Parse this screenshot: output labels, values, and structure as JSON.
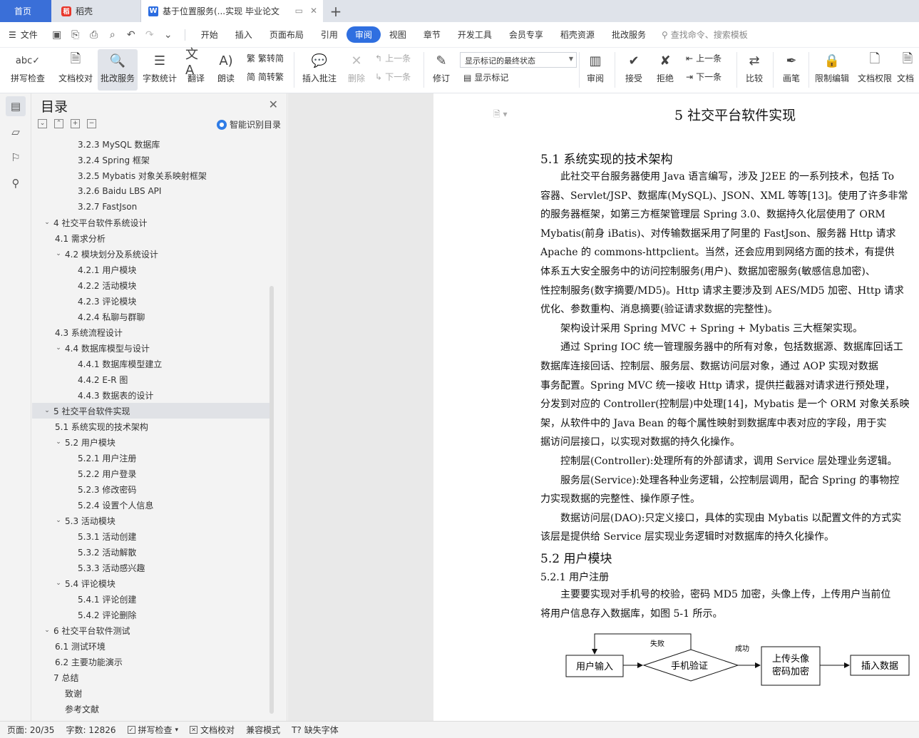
{
  "tabs": {
    "home": "首页",
    "daoke": "稻壳",
    "doc": "基于位置服务(...实现 毕业论文"
  },
  "menubar": {
    "file": "文件",
    "items": [
      "开始",
      "插入",
      "页面布局",
      "引用",
      "审阅",
      "视图",
      "章节",
      "开发工具",
      "会员专享",
      "稻壳资源",
      "批改服务"
    ],
    "active": "审阅",
    "search_placeholder": "查找命令、搜索模板"
  },
  "ribbon": {
    "spellcheck": "拼写检查",
    "doc_proof": "文档校对",
    "batch_service": "批改服务",
    "word_count": "字数统计",
    "translate": "翻译",
    "read_aloud": "朗读",
    "to_simplified": "繁转简",
    "to_traditional": "简转繁",
    "insert_comment": "插入批注",
    "delete": "删除",
    "prev": "上一条",
    "next": "下一条",
    "revise": "修订",
    "markup_state": "显示标记的最终状态",
    "show_markup": "显示标记",
    "review": "审阅",
    "accept": "接受",
    "reject": "拒绝",
    "prev2": "上一条",
    "next2": "下一条",
    "compare": "比较",
    "pen": "画笔",
    "restrict_edit": "限制编辑",
    "doc_permission": "文档权限",
    "doc_cut": "文档"
  },
  "toc": {
    "title": "目录",
    "smart": "智能识别目录",
    "items": [
      {
        "text": "3.2.3 MySQL 数据库",
        "level": 3
      },
      {
        "text": "3.2.4 Spring 框架",
        "level": 3
      },
      {
        "text": "3.2.5 Mybatis 对象关系映射框架",
        "level": 3
      },
      {
        "text": "3.2.6 Baidu LBS API",
        "level": 3
      },
      {
        "text": "3.2.7 FastJson",
        "level": 3
      },
      {
        "text": "4 社交平台软件系统设计",
        "level": 1,
        "toggle": true
      },
      {
        "text": "4.1 需求分析",
        "level": 2
      },
      {
        "text": "4.2 模块划分及系统设计",
        "level": 2,
        "toggle": true
      },
      {
        "text": "4.2.1 用户模块",
        "level": 3
      },
      {
        "text": "4.2.2 活动模块",
        "level": 3
      },
      {
        "text": "4.2.3 评论模块",
        "level": 3
      },
      {
        "text": "4.2.4 私聊与群聊",
        "level": 3
      },
      {
        "text": "4.3 系统流程设计",
        "level": 2
      },
      {
        "text": "4.4 数据库模型与设计",
        "level": 2,
        "toggle": true
      },
      {
        "text": "4.4.1 数据库模型建立",
        "level": 3
      },
      {
        "text": "4.4.2 E-R 图",
        "level": 3
      },
      {
        "text": "4.4.3 数据表的设计",
        "level": 3
      },
      {
        "text": "5 社交平台软件实现",
        "level": 1,
        "toggle": true,
        "selected": true
      },
      {
        "text": "5.1 系统实现的技术架构",
        "level": 2
      },
      {
        "text": "5.2 用户模块",
        "level": 2,
        "toggle": true
      },
      {
        "text": "5.2.1 用户注册",
        "level": 3
      },
      {
        "text": "5.2.2 用户登录",
        "level": 3
      },
      {
        "text": "5.2.3 修改密码",
        "level": 3
      },
      {
        "text": "5.2.4 设置个人信息",
        "level": 3
      },
      {
        "text": "5.3 活动模块",
        "level": 2,
        "toggle": true
      },
      {
        "text": "5.3.1 活动创建",
        "level": 3
      },
      {
        "text": "5.3.2 活动解散",
        "level": 3
      },
      {
        "text": "5.3.3 活动感兴趣",
        "level": 3
      },
      {
        "text": "5.4 评论模块",
        "level": 2,
        "toggle": true
      },
      {
        "text": "5.4.1 评论创建",
        "level": 3
      },
      {
        "text": "5.4.2 评论删除",
        "level": 3
      },
      {
        "text": "6 社交平台软件测试",
        "level": 1,
        "toggle": true
      },
      {
        "text": "6.1 测试环境",
        "level": 2
      },
      {
        "text": "6.2 主要功能演示",
        "level": 2
      },
      {
        "text": "7 总结",
        "level": 1
      },
      {
        "text": "致谢",
        "level": 0
      },
      {
        "text": "参考文献",
        "level": 0
      }
    ]
  },
  "page": {
    "chapter": "5  社交平台软件实现",
    "h51": "5.1  系统实现的技术架构",
    "lines": [
      "此社交平台服务器使用 Java 语言编写，涉及 J2EE 的一系列技术，包括 To",
      "容器、Servlet/JSP、数据库(MySQL)、JSON、XML 等等[13]。使用了许多非常",
      "的服务器框架，如第三方框架管理层 Spring 3.0、数据持久化层使用了 ORM",
      "Mybatis(前身 iBatis)、对传输数据采用了阿里的 FastJson、服务器 Http 请求",
      "Apache 的 commons-httpclient。当然，还会应用到网络方面的技术，有提供",
      "体系五大安全服务中的访问控制服务(用户)、数据加密服务(敏感信息加密)、",
      "性控制服务(数字摘要/MD5)。Http 请求主要涉及到 AES/MD5 加密、Http 请求",
      "优化、参数重构、消息摘要(验证请求数据的完整性)。",
      "架构设计采用 Spring MVC + Spring + Mybatis 三大框架实现。",
      "通过 Spring IOC 统一管理服务器中的所有对象，包括数据源、数据库回话工",
      "数据库连接回话、控制层、服务层、数据访问层对象，通过 AOP 实现对数据",
      "事务配置。Spring MVC 统一接收 Http 请求，提供拦截器对请求进行预处理，",
      "分发到对应的 Controller(控制层)中处理[14]，Mybatis 是一个 ORM 对象关系映",
      "架，从软件中的 Java Bean 的每个属性映射到数据库中表对应的字段，用于实",
      "据访问层接口，以实现对数据的持久化操作。",
      "控制层(Controller):处理所有的外部请求，调用 Service 层处理业务逻辑。",
      "服务层(Service):处理各种业务逻辑，公控制层调用，配合 Spring 的事物控",
      "力实现数据的完整性、操作原子性。",
      "数据访问层(DAO):只定义接口，具体的实现由 Mybatis 以配置文件的方式实",
      "该层是提供给 Service 层实现业务逻辑时对数据库的持久化操作。"
    ],
    "h52": "5.2  用户模块",
    "h521": "5.2.1  用户注册",
    "lines2": [
      "主要要实现对手机号的校验，密码 MD5 加密，头像上传，上传用户当前位",
      "将用户信息存入数据库，如图 5-1 所示。"
    ],
    "flow": {
      "user_input": "用户输入",
      "phone_verify": "手机验证",
      "fail": "失败",
      "success": "成功",
      "upload_1": "上传头像",
      "upload_2": "密码加密",
      "insert": "插入数据"
    }
  },
  "status": {
    "page": "页面: 20/35",
    "words": "字数: 12826",
    "spell": "拼写检查",
    "proof": "文档校对",
    "compat": "兼容模式",
    "font": "缺失字体"
  }
}
